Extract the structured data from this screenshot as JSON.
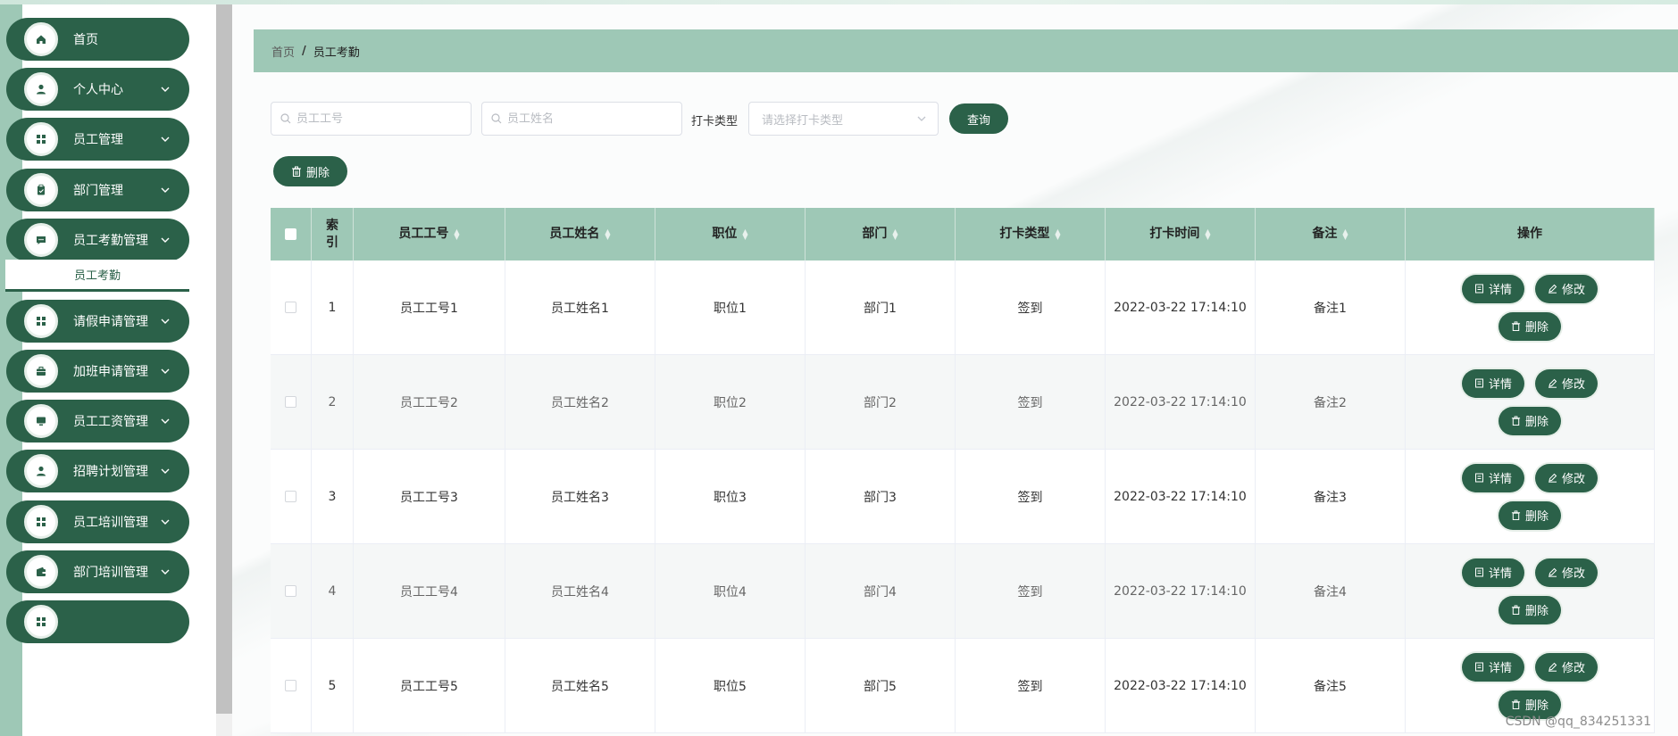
{
  "sidebar": {
    "items": [
      {
        "label": "首页",
        "icon": "home-icon",
        "has_children": false
      },
      {
        "label": "个人中心",
        "icon": "user-icon",
        "has_children": true
      },
      {
        "label": "员工管理",
        "icon": "grid-icon",
        "has_children": true
      },
      {
        "label": "部门管理",
        "icon": "clipboard-icon",
        "has_children": true
      },
      {
        "label": "员工考勤管理",
        "icon": "chat-icon",
        "has_children": true
      },
      {
        "label": "请假申请管理",
        "icon": "grid-icon",
        "has_children": true
      },
      {
        "label": "加班申请管理",
        "icon": "briefcase-icon",
        "has_children": true
      },
      {
        "label": "员工工资管理",
        "icon": "monitor-icon",
        "has_children": true
      },
      {
        "label": "招聘计划管理",
        "icon": "user-icon",
        "has_children": true
      },
      {
        "label": "员工培训管理",
        "icon": "grid-icon",
        "has_children": true
      },
      {
        "label": "部门培训管理",
        "icon": "wallet-icon",
        "has_children": true
      }
    ],
    "active_submenu": "员工考勤"
  },
  "breadcrumb": {
    "home": "首页",
    "separator": "/",
    "current": "员工考勤"
  },
  "search": {
    "employee_no_placeholder": "员工工号",
    "employee_name_placeholder": "员工姓名",
    "punch_type_label": "打卡类型",
    "punch_type_placeholder": "请选择打卡类型",
    "query_label": "查询"
  },
  "toolbar": {
    "delete_label": "删除"
  },
  "table": {
    "columns": [
      "索引",
      "员工工号",
      "员工姓名",
      "职位",
      "部门",
      "打卡类型",
      "打卡时间",
      "备注",
      "操作"
    ],
    "rows": [
      {
        "index": "1",
        "employee_no": "员工工号1",
        "employee_name": "员工姓名1",
        "position": "职位1",
        "department": "部门1",
        "punch_type": "签到",
        "punch_time": "2022-03-22 17:14:10",
        "remark": "备注1"
      },
      {
        "index": "2",
        "employee_no": "员工工号2",
        "employee_name": "员工姓名2",
        "position": "职位2",
        "department": "部门2",
        "punch_type": "签到",
        "punch_time": "2022-03-22 17:14:10",
        "remark": "备注2"
      },
      {
        "index": "3",
        "employee_no": "员工工号3",
        "employee_name": "员工姓名3",
        "position": "职位3",
        "department": "部门3",
        "punch_type": "签到",
        "punch_time": "2022-03-22 17:14:10",
        "remark": "备注3"
      },
      {
        "index": "4",
        "employee_no": "员工工号4",
        "employee_name": "员工姓名4",
        "position": "职位4",
        "department": "部门4",
        "punch_type": "签到",
        "punch_time": "2022-03-22 17:14:10",
        "remark": "备注4"
      },
      {
        "index": "5",
        "employee_no": "员工工号5",
        "employee_name": "员工姓名5",
        "position": "职位5",
        "department": "部门5",
        "punch_type": "签到",
        "punch_time": "2022-03-22 17:14:10",
        "remark": "备注5"
      }
    ],
    "actions": {
      "detail": "详情",
      "edit": "修改",
      "delete": "删除"
    }
  },
  "watermark": "CSDN @qq_834251331",
  "colors": {
    "primary": "#2b6149",
    "accent_light": "#9ec8b6"
  }
}
